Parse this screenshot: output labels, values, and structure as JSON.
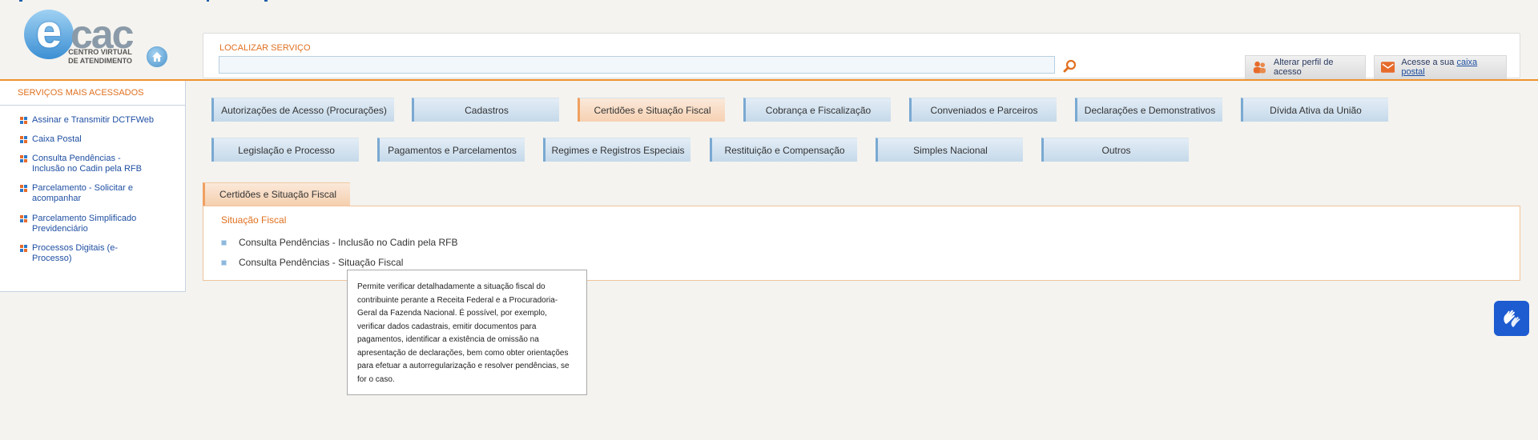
{
  "header": {
    "logo": {
      "letter_e": "e",
      "letters_cac": "cac",
      "subtitle_line1": "CENTRO VIRTUAL",
      "subtitle_line2": "DE ATENDIMENTO"
    },
    "search": {
      "label": "LOCALIZAR SERVIÇO",
      "value": "",
      "placeholder": ""
    },
    "buttons": {
      "profile_label": "Alterar perfil de acesso",
      "mailbox_prefix": "Acesse a sua ",
      "mailbox_link": "caixa postal"
    }
  },
  "sidebar": {
    "title": "SERVIÇOS MAIS ACESSADOS",
    "items": [
      {
        "label": "Assinar e Transmitir DCTFWeb"
      },
      {
        "label": "Caixa Postal"
      },
      {
        "label": "Consulta Pendências - Inclusão no Cadin pela RFB"
      },
      {
        "label": "Parcelamento - Solicitar e acompanhar"
      },
      {
        "label": "Parcelamento Simplificado Previdenciário"
      },
      {
        "label": "Processos Digitais (e-Processo)"
      }
    ]
  },
  "categories": {
    "row1": [
      {
        "label": "Autorizações de Acesso (Procurações)"
      },
      {
        "label": "Cadastros"
      },
      {
        "label": "Certidões e Situação Fiscal",
        "active": true
      },
      {
        "label": "Cobrança e Fiscalização"
      },
      {
        "label": "Conveniados e Parceiros"
      },
      {
        "label": "Declarações e Demonstrativos"
      },
      {
        "label": "Dívida Ativa da União"
      }
    ],
    "row2": [
      {
        "label": "Legislação e Processo"
      },
      {
        "label": "Pagamentos e Parcelamentos"
      },
      {
        "label": "Regimes e Registros Especiais"
      },
      {
        "label": "Restituição e Compensação"
      },
      {
        "label": "Simples Nacional"
      },
      {
        "label": "Outros"
      }
    ]
  },
  "panel": {
    "tab_label": "Certidões e Situação Fiscal",
    "section_title": "Situação Fiscal",
    "items": [
      {
        "label": "Consulta Pendências - Inclusão no Cadin pela RFB"
      },
      {
        "label": "Consulta Pendências - Situação Fiscal"
      }
    ]
  },
  "tooltip": {
    "text": "Permite verificar detalhadamente a situação fiscal do contribuinte perante a Receita Federal e a Procuradoria-Geral da Fazenda Nacional. É possível, por exemplo, verificar dados cadastrais, emitir documentos para pagamentos, identificar a existência de omissão na apresentação de declarações, bem como obter orientações para efetuar a autorregularização e resolver pendências, se for o caso."
  },
  "colors": {
    "accent_orange": "#e07020",
    "link_blue": "#1f4fa2",
    "tab_blue": "#c5d9ea",
    "tab_active": "#f6d1b2",
    "vlibras_blue": "#1d5bd1"
  },
  "icons": {
    "home": "home-icon",
    "search": "search-icon",
    "profile": "users-icon",
    "mailbox": "envelope-icon",
    "accessibility": "sign-language-hands-icon"
  }
}
